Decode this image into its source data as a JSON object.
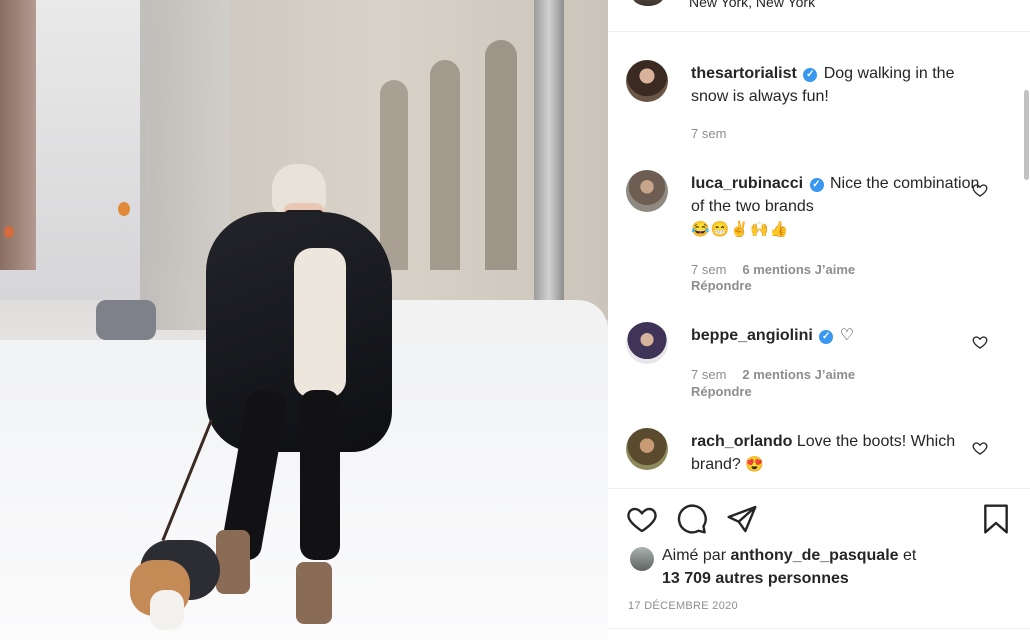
{
  "header": {
    "location": "New York, New York"
  },
  "photo": {
    "description_icon": "post-photo"
  },
  "caption": {
    "username": "thesartorialist",
    "verified": true,
    "text": "Dog walking in the snow is always fun!",
    "time": "7 sem"
  },
  "comments": [
    {
      "username": "luca_rubinacci",
      "verified": true,
      "text": "Nice the combination of the two brands",
      "emoji": "😂😁✌🙌👍",
      "time": "7 sem",
      "likes": "6 mentions J’aime",
      "reply": "Répondre"
    },
    {
      "username": "beppe_angiolini",
      "verified": true,
      "text": "♡",
      "time": "7 sem",
      "likes": "2 mentions J’aime",
      "reply": "Répondre"
    },
    {
      "username": "rach_orlando",
      "verified": false,
      "text": "Love the boots! Which brand?",
      "emoji": "😍"
    }
  ],
  "likes": {
    "prefix": "Aimé par",
    "user": "anthony_de_pasquale",
    "suffix": "et",
    "others": "13 709 autres personnes"
  },
  "date": "17 DÉCEMBRE 2020",
  "colors": {
    "verified": "#3897f0",
    "meta": "#8e8e8e",
    "text": "#262626"
  },
  "icons": [
    "heart-icon",
    "comment-icon",
    "share-icon",
    "save-icon"
  ]
}
